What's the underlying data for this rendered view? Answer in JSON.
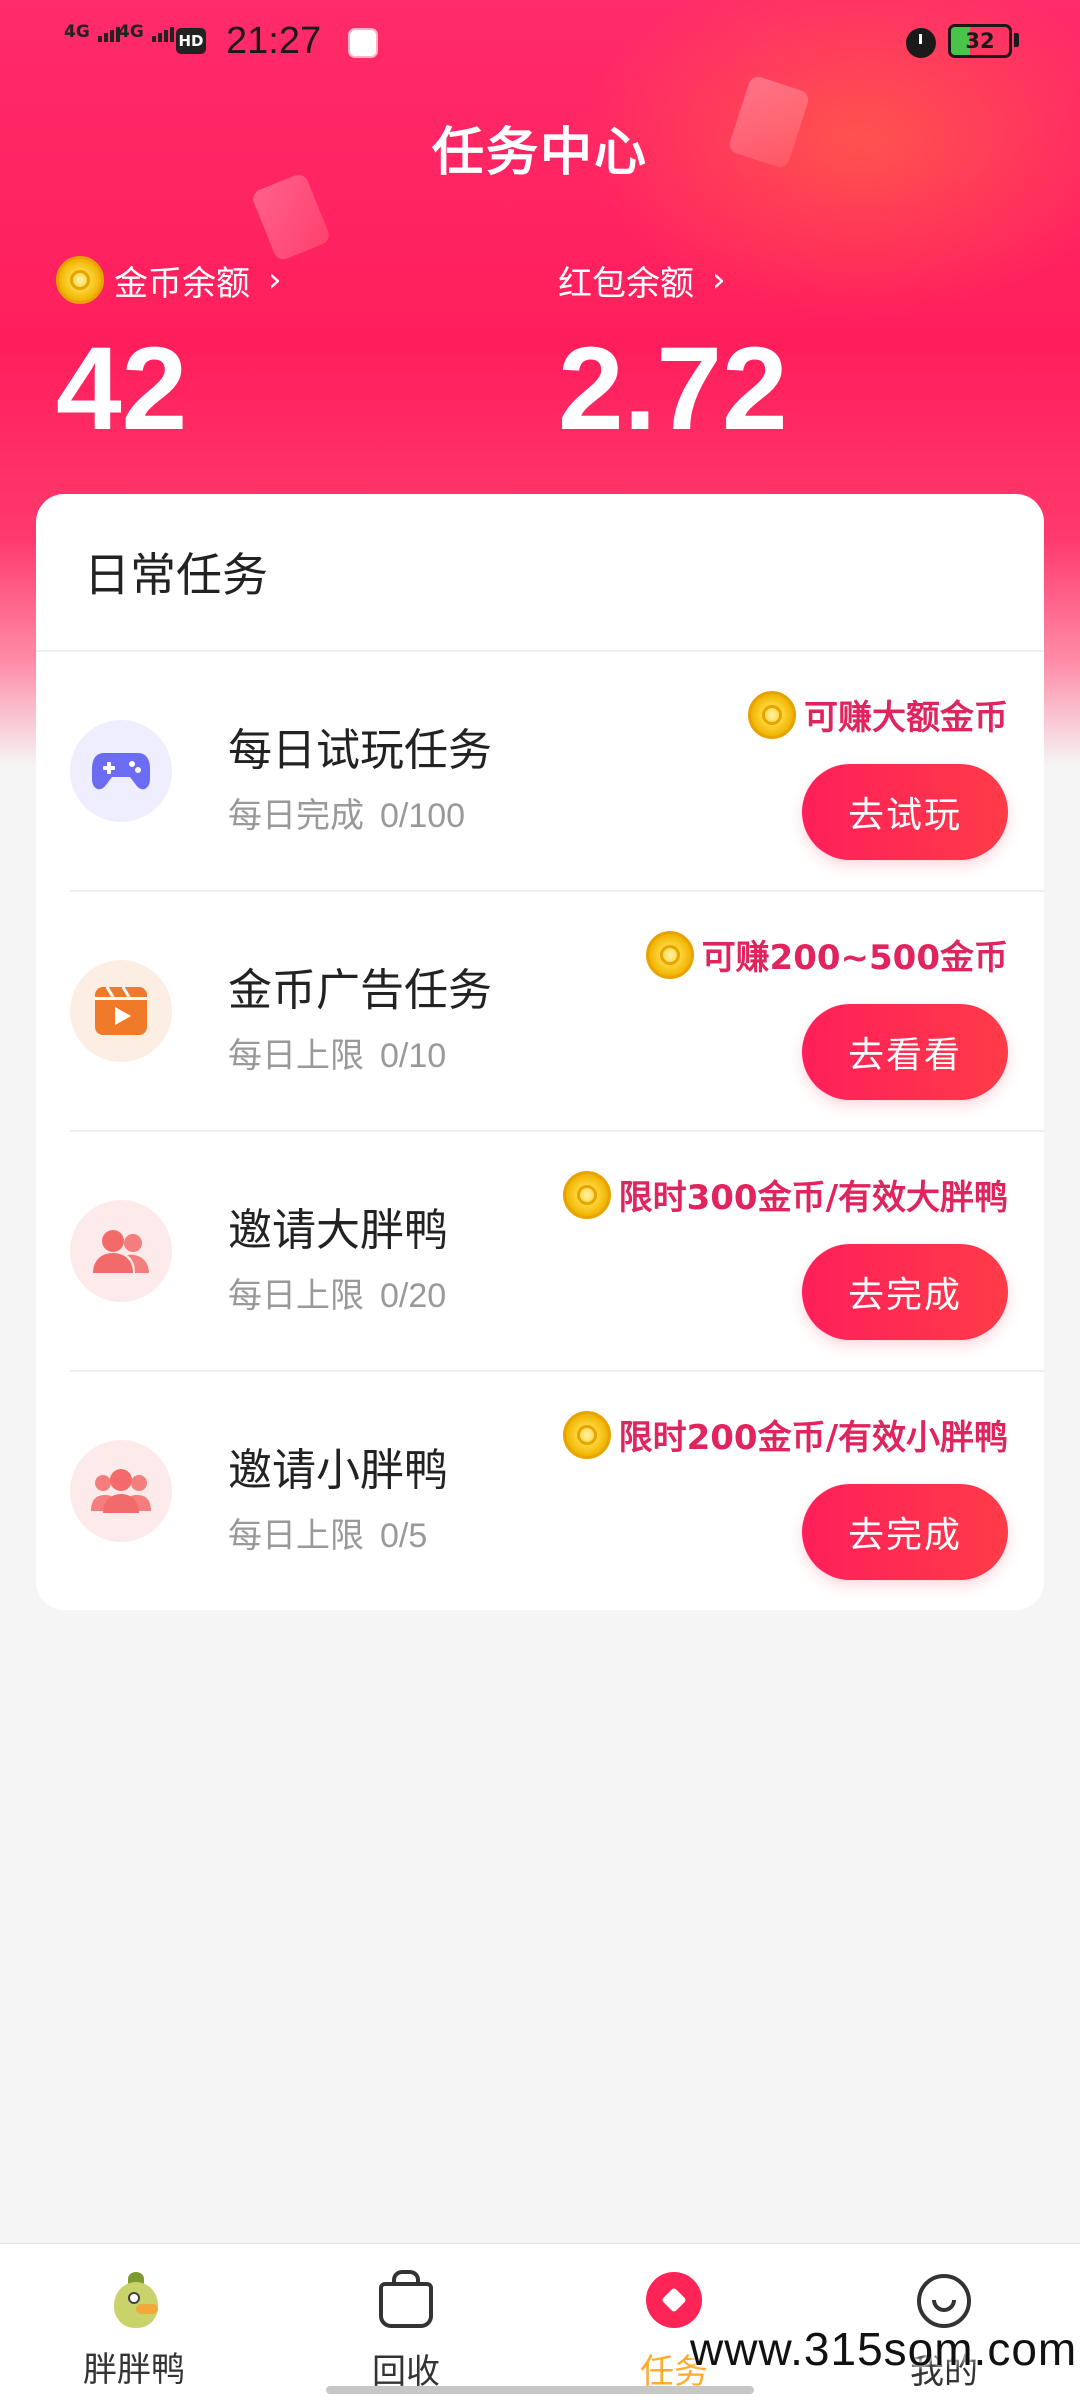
{
  "status_bar": {
    "signal1": "4G",
    "signal2": "4G",
    "hd": "HD",
    "time": "21:27",
    "battery_level": "32",
    "battery_percent": 0.32
  },
  "header": {
    "title": "任务中心"
  },
  "balances": {
    "coin": {
      "label": "金币余额",
      "value": "42"
    },
    "red_packet": {
      "label": "红包余额",
      "value": "2.72"
    }
  },
  "daily_tasks": {
    "title": "日常任务",
    "items": [
      {
        "name": "每日试玩任务",
        "sub_label": "每日完成",
        "count": "0/100",
        "reward": "可赚大额金币",
        "button": "去试玩",
        "icon": "gamepad-icon",
        "icon_color": "#6c6cf2",
        "icon_bg": "#eeeefe"
      },
      {
        "name": "金币广告任务",
        "sub_label": "每日上限",
        "count": "0/10",
        "reward": "可赚200~500金币",
        "button": "去看看",
        "icon": "video-play-icon",
        "icon_color": "#f07a2a",
        "icon_bg": "#fdeee4"
      },
      {
        "name": "邀请大胖鸭",
        "sub_label": "每日上限",
        "count": "0/20",
        "reward": "限时300金币/有效大胖鸭",
        "button": "去完成",
        "icon": "users-icon",
        "icon_color": "#f26a6a",
        "icon_bg": "#fdebeb"
      },
      {
        "name": "邀请小胖鸭",
        "sub_label": "每日上限",
        "count": "0/5",
        "reward": "限时200金币/有效小胖鸭",
        "button": "去完成",
        "icon": "group-icon",
        "icon_color": "#f26a6a",
        "icon_bg": "#fdebeb"
      }
    ]
  },
  "bottom_nav": {
    "items": [
      {
        "label": "胖胖鸭",
        "icon": "duck-icon"
      },
      {
        "label": "回收",
        "icon": "basket-icon"
      },
      {
        "label": "任务",
        "icon": "task-icon",
        "active": true
      },
      {
        "label": "我的",
        "icon": "profile-icon"
      }
    ]
  },
  "watermark": "www.315som.com",
  "colors": {
    "accent": "#ff1f5a",
    "reward_text": "#e0245e",
    "active_nav": "#ffab2e"
  }
}
